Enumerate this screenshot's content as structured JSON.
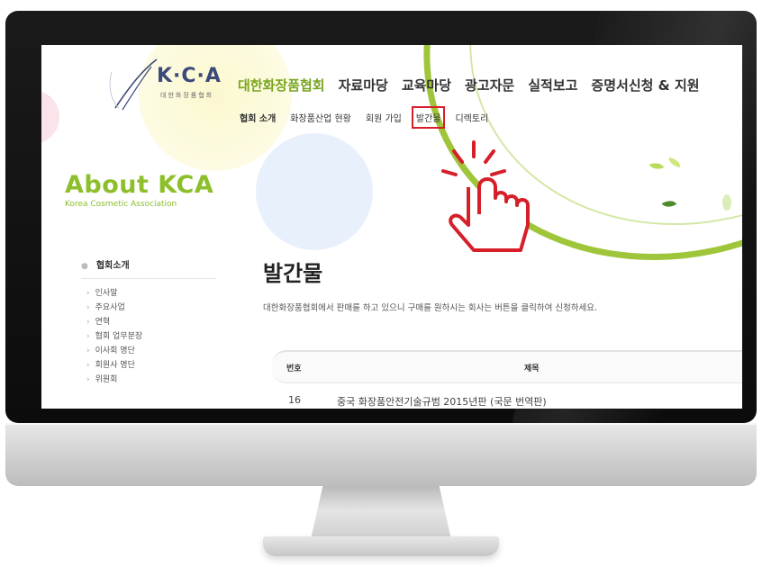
{
  "logo": {
    "letters": "K·C·A",
    "subtitle": "대한화장품협회",
    "ring_text": "Korea Cosmetic Association"
  },
  "main_nav": [
    "대한화장품협회",
    "자료마당",
    "교육마당",
    "광고자문",
    "실적보고",
    "증명서신청 & 지원"
  ],
  "sub_nav": [
    "협회 소개",
    "화장품산업 현황",
    "회원 가입",
    "발간물",
    "디렉토리"
  ],
  "highlighted_sub_nav": "발간물",
  "about": {
    "title": "About KCA",
    "subtitle": "Korea Cosmetic Association"
  },
  "sidebar": {
    "heading": "협회소개",
    "items": [
      "인사말",
      "주요사업",
      "연혁",
      "협회 업무분장",
      "이사회 명단",
      "회원사 명단",
      "위원회"
    ]
  },
  "content": {
    "page_title": "발간물",
    "intro": "대한화장품협회에서 판매를 하고 있으니 구매를 원하시는 회사는 버튼을 클릭하여 신청하세요.",
    "table": {
      "headers": [
        "번호",
        "제목"
      ],
      "rows": [
        {
          "no": "16",
          "title": "중국 화장품안전기술규범 2015년판 (국문 번역판)"
        }
      ]
    }
  },
  "colors": {
    "brand_green": "#8cbf2a",
    "highlight_red": "#d71f2a",
    "logo_navy": "#3b4a78"
  },
  "icons": [
    "tap-hand-icon",
    "leaf-icon"
  ]
}
